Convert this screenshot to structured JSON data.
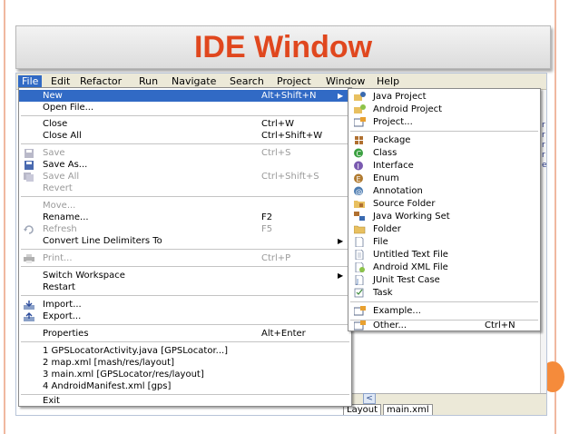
{
  "slide": {
    "title": "IDE Window",
    "accent_color": "#e0471e",
    "border_color": "#f0b8a0",
    "dot_color": "#f58b3b"
  },
  "menubar": {
    "items": [
      "File",
      "Edit",
      "Refactor",
      "Run",
      "Navigate",
      "Search",
      "Project",
      "Window",
      "Help"
    ],
    "active": "File"
  },
  "background": {
    "tabs": [
      "Layout",
      "main.xml"
    ],
    "scroll_left": "<",
    "edge_chars": [
      "r",
      "r",
      "r",
      "r",
      "",
      "",
      "",
      "",
      "e"
    ]
  },
  "file_menu": {
    "items": [
      {
        "label": "New",
        "accel": "Alt+Shift+N",
        "submenu": true,
        "highlighted": true
      },
      {
        "label": "Open File...",
        "accel": ""
      },
      {
        "label": "Close",
        "accel": "Ctrl+W"
      },
      {
        "label": "Close All",
        "accel": "Ctrl+Shift+W"
      },
      {
        "label": "Save",
        "accel": "Ctrl+S",
        "disabled": true,
        "icon": "save-icon"
      },
      {
        "label": "Save As...",
        "accel": "",
        "icon": "save-as-icon"
      },
      {
        "label": "Save All",
        "accel": "Ctrl+Shift+S",
        "disabled": true,
        "icon": "save-all-icon"
      },
      {
        "label": "Revert",
        "accel": "",
        "disabled": true
      },
      {
        "label": "Move...",
        "accel": "",
        "disabled": true
      },
      {
        "label": "Rename...",
        "accel": "F2"
      },
      {
        "label": "Refresh",
        "accel": "F5",
        "disabled": true,
        "icon": "refresh-icon"
      },
      {
        "label": "Convert Line Delimiters To",
        "accel": "",
        "submenu": true
      },
      {
        "label": "Print...",
        "accel": "Ctrl+P",
        "disabled": true,
        "icon": "print-icon"
      },
      {
        "label": "Switch Workspace",
        "accel": "",
        "submenu": true
      },
      {
        "label": "Restart",
        "accel": ""
      },
      {
        "label": "Import...",
        "accel": "",
        "icon": "import-icon"
      },
      {
        "label": "Export...",
        "accel": "",
        "icon": "export-icon"
      },
      {
        "label": "Properties",
        "accel": "Alt+Enter"
      },
      {
        "label": "1 GPSLocatorActivity.java  [GPSLocator...]",
        "accel": ""
      },
      {
        "label": "2 map.xml  [mash/res/layout]",
        "accel": ""
      },
      {
        "label": "3 main.xml  [GPSLocator/res/layout]",
        "accel": ""
      },
      {
        "label": "4 AndroidManifest.xml  [gps]",
        "accel": ""
      },
      {
        "label": "Exit",
        "accel": ""
      }
    ]
  },
  "new_submenu": {
    "items": [
      {
        "label": "Java Project",
        "icon": "java-project-icon"
      },
      {
        "label": "Android Project",
        "icon": "android-project-icon"
      },
      {
        "label": "Project...",
        "icon": "project-icon"
      },
      {
        "label": "Package",
        "icon": "package-icon"
      },
      {
        "label": "Class",
        "icon": "class-icon"
      },
      {
        "label": "Interface",
        "icon": "interface-icon"
      },
      {
        "label": "Enum",
        "icon": "enum-icon"
      },
      {
        "label": "Annotation",
        "icon": "annotation-icon"
      },
      {
        "label": "Source Folder",
        "icon": "source-folder-icon"
      },
      {
        "label": "Java Working Set",
        "icon": "working-set-icon"
      },
      {
        "label": "Folder",
        "icon": "folder-icon"
      },
      {
        "label": "File",
        "icon": "file-icon"
      },
      {
        "label": "Untitled Text File",
        "icon": "text-file-icon"
      },
      {
        "label": "Android XML File",
        "icon": "android-xml-icon"
      },
      {
        "label": "JUnit Test Case",
        "icon": "junit-icon"
      },
      {
        "label": "Task",
        "icon": "task-icon"
      },
      {
        "label": "Example...",
        "icon": "example-icon"
      },
      {
        "label": "Other...",
        "accel": "Ctrl+N",
        "icon": "other-icon"
      }
    ]
  }
}
